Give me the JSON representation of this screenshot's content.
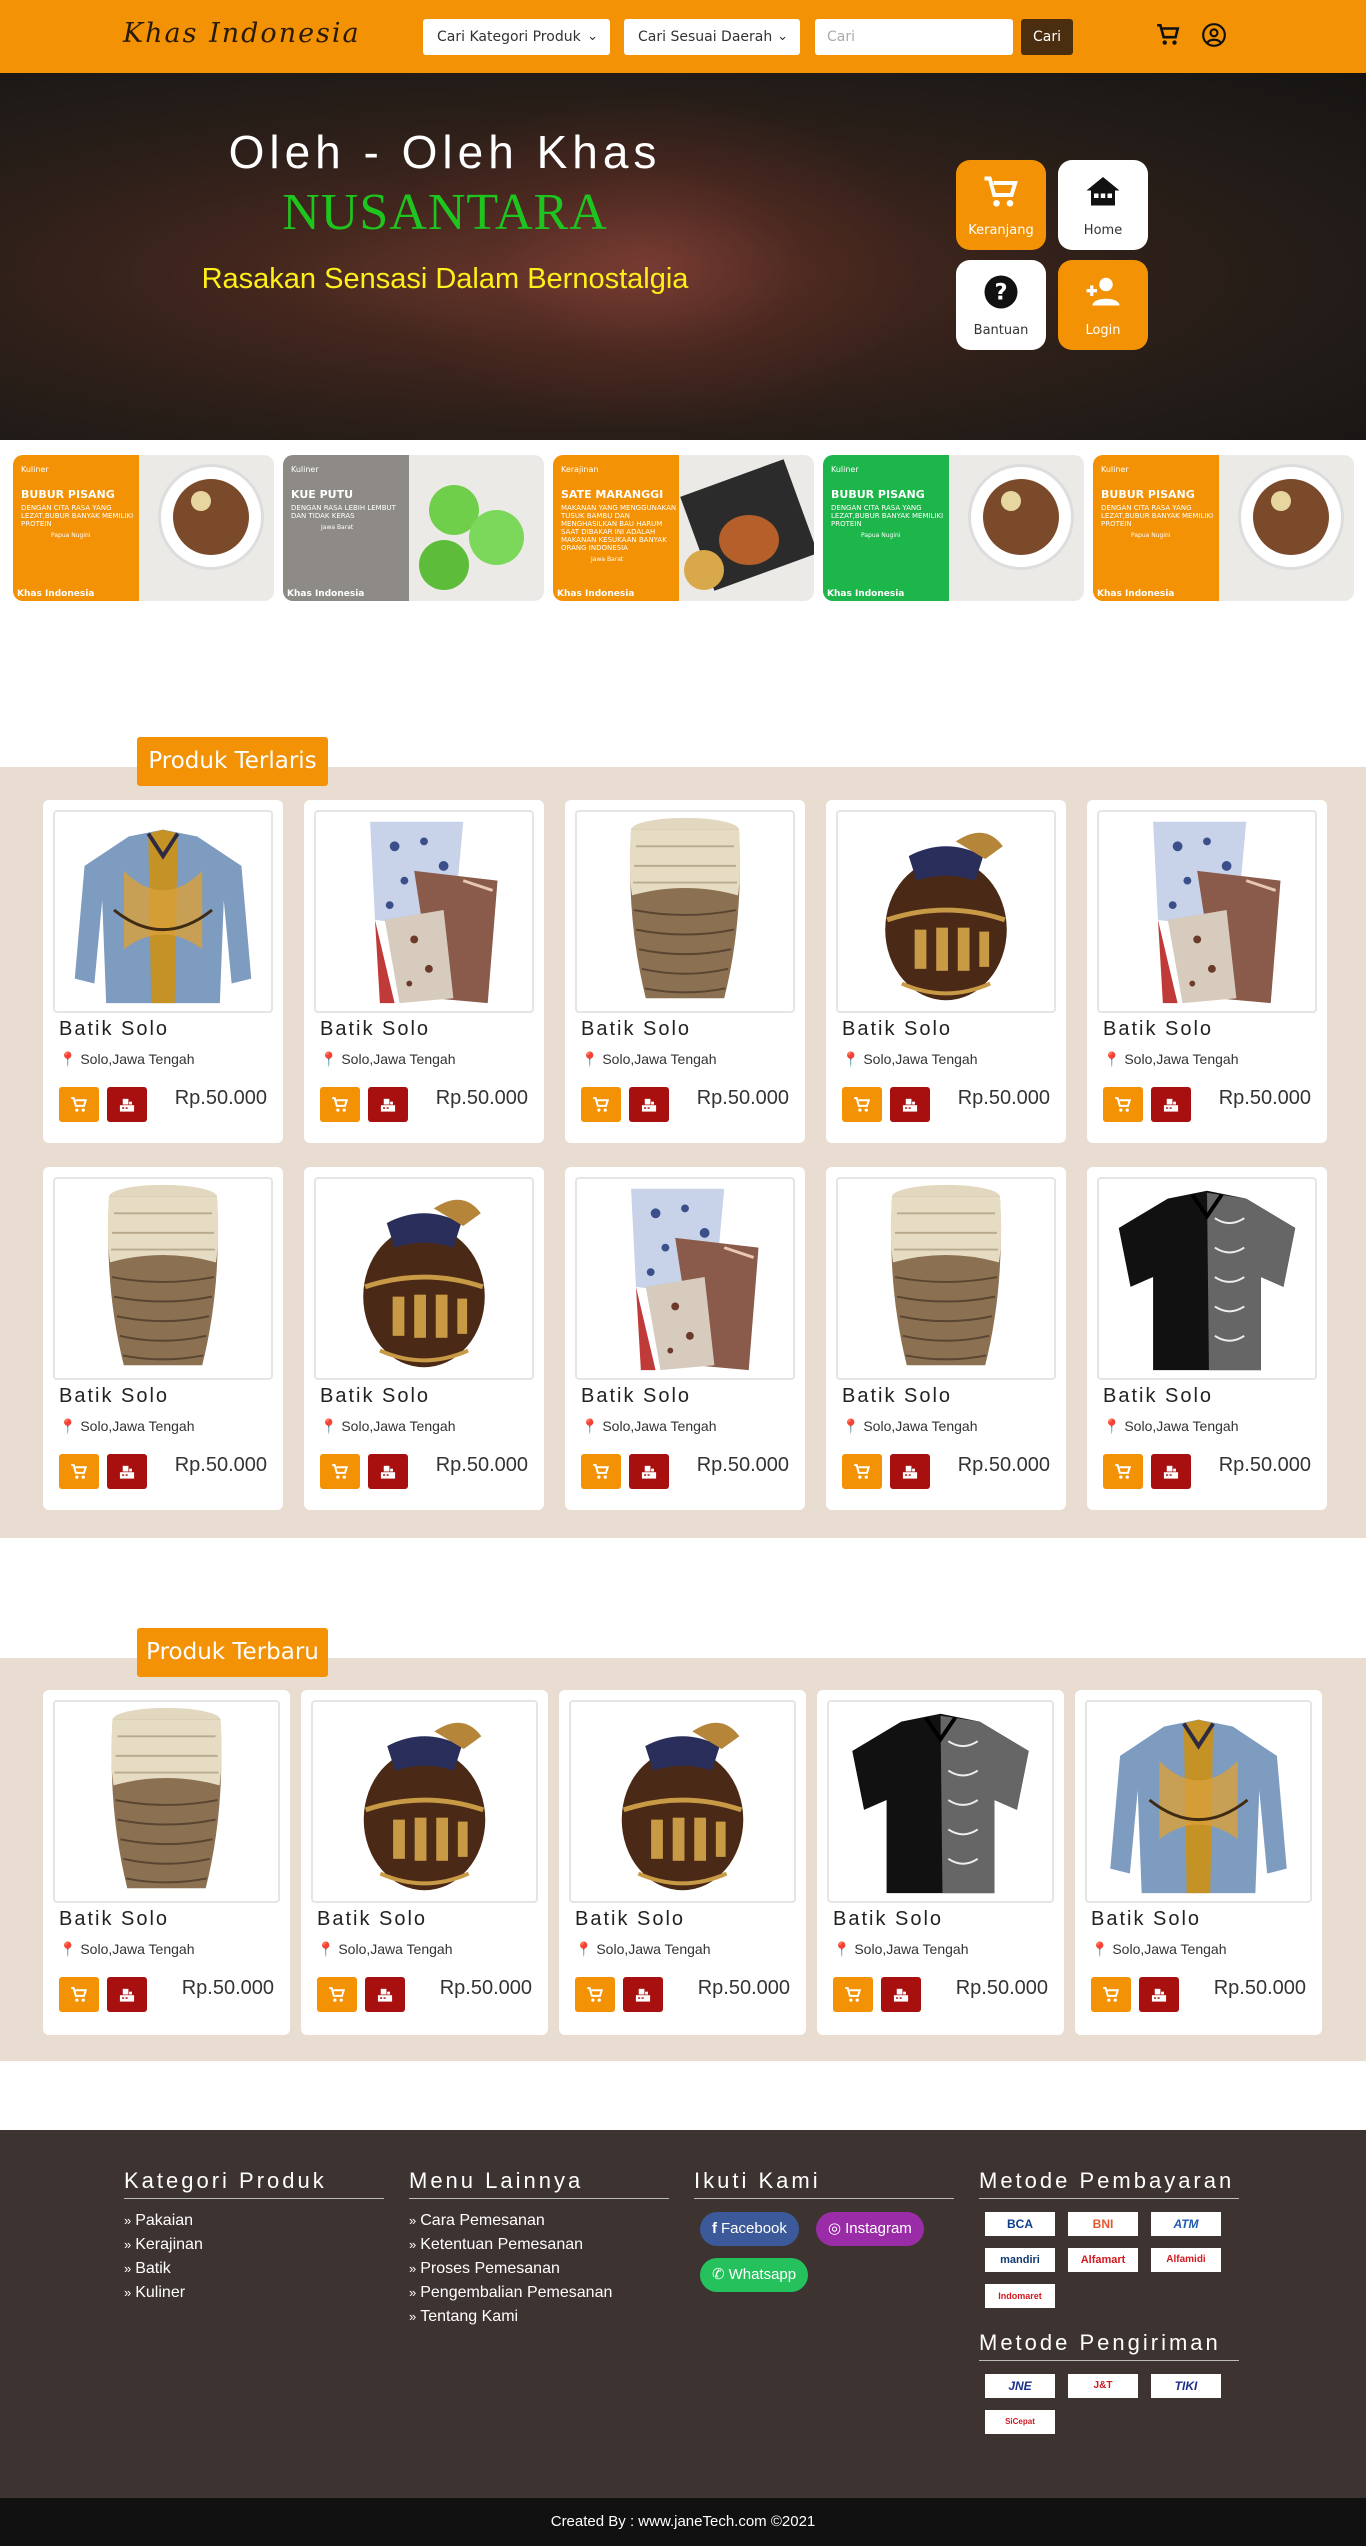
{
  "nav": {
    "brand": "Khas Indonesia",
    "category_select": "Cari Kategori Produk",
    "region_select": "Cari Sesuai Daerah",
    "search_placeholder": "Cari",
    "search_button": "Cari"
  },
  "hero": {
    "line1": "Oleh - Oleh Khas",
    "line2": "NUSANTARA",
    "line3": "Rasakan Sensasi Dalam Bernostalgia",
    "tiles": [
      {
        "label": "Keranjang",
        "icon": "cart-icon"
      },
      {
        "label": "Home",
        "icon": "home-icon"
      },
      {
        "label": "Bantuan",
        "icon": "help-icon"
      },
      {
        "label": "Login",
        "icon": "add-user-icon"
      }
    ]
  },
  "banners": [
    {
      "category": "Kuliner",
      "title": "BUBUR PISANG",
      "desc": "DENGAN CITA RASA YANG LEZAT,BUBUR BANYAK MEMILIKI PROTEIN",
      "place": "Papua Nugini",
      "footer": "Khas Indonesia",
      "color": "#f39205"
    },
    {
      "category": "Kuliner",
      "title": "KUE PUTU",
      "desc": "DENGAN RASA LEBIH LEMBUT DAN TIDAK KERAS",
      "place": "Jawa Barat",
      "footer": "Khas Indonesia",
      "color": "#8e8b86"
    },
    {
      "category": "Kerajinan",
      "title": "SATE MARANGGI",
      "desc": "MAKANAN YANG MENGGUNAKAN TUSUK BAMBU DAN MENGHASILKAN BAU HARUM SAAT DIBAKAR INI ADALAH MAKANAN KESUKAAN BANYAK ORANG INDONESIA",
      "place": "Jawa Barat",
      "footer": "Khas Indonesia",
      "color": "#f39205"
    },
    {
      "category": "Kuliner",
      "title": "BUBUR PISANG",
      "desc": "DENGAN CITA RASA YANG LEZAT,BUBUR BANYAK MEMILIKI PROTEIN",
      "place": "Papua Nugini",
      "footer": "Khas Indonesia",
      "color": "#1db64a"
    },
    {
      "category": "Kuliner",
      "title": "BUBUR PISANG",
      "desc": "DENGAN CITA RASA YANG LEZAT,BUBUR BANYAK MEMILIKI PROTEIN",
      "place": "Papua Nugini",
      "footer": "Khas Indonesia",
      "color": "#f39205"
    }
  ],
  "terlaris": {
    "title": "Produk Terlaris",
    "products": [
      {
        "name": "Batik Solo",
        "location": "Solo,Jawa Tengah",
        "price": "Rp.50.000",
        "image": "batik-shirt"
      },
      {
        "name": "Batik Solo",
        "location": "Solo,Jawa Tengah",
        "price": "Rp.50.000",
        "image": "batik-fabric"
      },
      {
        "name": "Batik Solo",
        "location": "Solo,Jawa Tengah",
        "price": "Rp.50.000",
        "image": "woven-basket"
      },
      {
        "name": "Batik Solo",
        "location": "Solo,Jawa Tengah",
        "price": "Rp.50.000",
        "image": "carved-jar"
      },
      {
        "name": "Batik Solo",
        "location": "Solo,Jawa Tengah",
        "price": "Rp.50.000",
        "image": "batik-fabric"
      },
      {
        "name": "Batik Solo",
        "location": "Solo,Jawa Tengah",
        "price": "Rp.50.000",
        "image": "woven-basket"
      },
      {
        "name": "Batik Solo",
        "location": "Solo,Jawa Tengah",
        "price": "Rp.50.000",
        "image": "carved-jar"
      },
      {
        "name": "Batik Solo",
        "location": "Solo,Jawa Tengah",
        "price": "Rp.50.000",
        "image": "batik-fabric"
      },
      {
        "name": "Batik Solo",
        "location": "Solo,Jawa Tengah",
        "price": "Rp.50.000",
        "image": "woven-basket"
      },
      {
        "name": "Batik Solo",
        "location": "Solo,Jawa Tengah",
        "price": "Rp.50.000",
        "image": "black-batik-shirt"
      }
    ]
  },
  "terbaru": {
    "title": "Produk Terbaru",
    "products": [
      {
        "name": "Batik Solo",
        "location": "Solo,Jawa Tengah",
        "price": "Rp.50.000",
        "image": "woven-basket"
      },
      {
        "name": "Batik Solo",
        "location": "Solo,Jawa Tengah",
        "price": "Rp.50.000",
        "image": "carved-jar"
      },
      {
        "name": "Batik Solo",
        "location": "Solo,Jawa Tengah",
        "price": "Rp.50.000",
        "image": "carved-jar"
      },
      {
        "name": "Batik Solo",
        "location": "Solo,Jawa Tengah",
        "price": "Rp.50.000",
        "image": "black-batik-shirt"
      },
      {
        "name": "Batik Solo",
        "location": "Solo,Jawa Tengah",
        "price": "Rp.50.000",
        "image": "batik-shirt"
      }
    ]
  },
  "footer": {
    "kategori": {
      "title": "Kategori Produk",
      "items": [
        "Pakaian",
        "Kerajinan",
        "Batik",
        "Kuliner"
      ]
    },
    "menu": {
      "title": "Menu Lainnya",
      "items": [
        "Cara Pemesanan",
        "Ketentuan Pemesanan",
        "Proses Pemesanan",
        "Pengembalian Pemesanan",
        "Tentang Kami"
      ]
    },
    "ikuti": {
      "title": "Ikuti Kami",
      "facebook": "Facebook",
      "instagram": "Instagram",
      "whatsapp": "Whatsapp"
    },
    "pembayaran": {
      "title": "Metode Pembayaran",
      "logos": [
        "BCA",
        "BNI",
        "ATM",
        "mandiri",
        "Alfamart",
        "Alfamidi",
        "Indomaret"
      ]
    },
    "pengiriman": {
      "title": "Metode Pengiriman",
      "logos": [
        "JNE",
        "J&T",
        "TIKI",
        "SiCepat"
      ]
    },
    "copyright": "Created By : www.janeTech.com ©2021"
  },
  "colors": {
    "accent": "#f39205",
    "dark_brown": "#4b2e10",
    "buy_red": "#a80f0f",
    "section_bg": "#e9ddd1",
    "footer_bg": "#3d3331"
  }
}
